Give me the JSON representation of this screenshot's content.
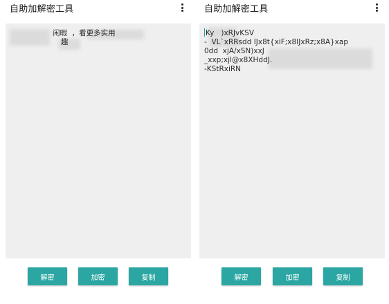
{
  "left": {
    "title": "自助加解密工具",
    "editor_lines": [
      "闲暇  ，看更多实用",
      "趣"
    ],
    "buttons": {
      "decrypt": "解密",
      "encrypt": "加密",
      "copy": "复制"
    }
  },
  "right": {
    "title": "自助加解密工具",
    "editor_lines": [
      "Ky   )xRJvKSV",
      "-  VL`xRRsdd IJx8t{xiF;x8IJxRz;x8A}xap",
      "0dd  xjA/xSN)xxJ",
      "_xxp;xjl@x8XHddJ.  ",
      "-KStRxiRN"
    ],
    "buttons": {
      "decrypt": "解密",
      "encrypt": "加密",
      "copy": "复制"
    }
  },
  "icons": {
    "overflow_menu": "more-vert-icon"
  },
  "colors": {
    "accent": "#2ba6a2",
    "editor_bg": "#efefef"
  }
}
